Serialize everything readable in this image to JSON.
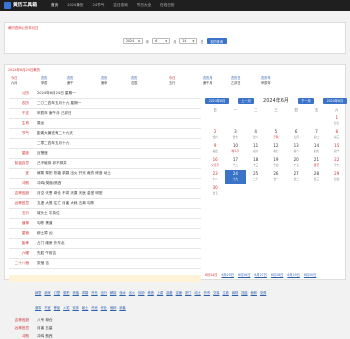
{
  "brand": {
    "name": "黄历工具箱",
    "sub": "www.xxx.com"
  },
  "nav": [
    "首页",
    "2024黄历",
    "24节气",
    "吉日查询",
    "节日大全",
    "在线日历"
  ],
  "query": {
    "title": "黄历查询公历年月日",
    "year": "2024",
    "year_unit": "年",
    "month": "6",
    "month_unit": "月",
    "day": "24",
    "day_unit": "日",
    "submit": "农历查询"
  },
  "main": {
    "title": "2024年6月24日黄历",
    "weekdays_row1": [
      "今日",
      "农历",
      "农历",
      "农历",
      "农历",
      "今日",
      "农历月",
      "农历日",
      "农历年"
    ],
    "weekdays_row2": [
      "六月",
      "甲辰",
      "庚午",
      "庚申",
      "戊辰",
      "五行",
      "庚午月",
      "乙卯日",
      "甲辰年"
    ],
    "info": [
      {
        "k": "公历",
        "v": "2024年6月24日 星期一"
      },
      {
        "k": "农历",
        "v": "二〇二四年五月十九 星期一"
      },
      {
        "k": "干支",
        "v": "甲辰年 庚午月 己卯日"
      },
      {
        "k": "生肖",
        "v": "属龙"
      },
      {
        "k": "节气",
        "v": "距离大暑还有二十九天"
      },
      {
        "k": "",
        "v": "二零二四年五月十九"
      },
      {
        "k": "星座",
        "v": "巨蟹座"
      },
      {
        "k": "彭祖百忌",
        "v": "己不破券 卯不穿井"
      },
      {
        "k": "宜",
        "v": "嫁娶 祭祀 祈福 求嗣 出火 开光 裁衣 修造 动土"
      },
      {
        "k": "冲煞",
        "v": "冲鸡(癸酉)煞西"
      },
      {
        "k": "吉神宜趋",
        "v": "月空 天恩 母仓 不将 天喜 天医 金堂 明堂"
      },
      {
        "k": "凶神宜忌",
        "v": "五虚 大煞 往亡 月害 大耗 五离 勾陈"
      },
      {
        "k": "五行",
        "v": "城头土 平执位"
      },
      {
        "k": "值神",
        "v": "勾陈 黑道"
      },
      {
        "k": "星宿",
        "v": "柳土獐 凶"
      },
      {
        "k": "胎神",
        "v": "占门 碓房 外东北"
      },
      {
        "k": "六曜",
        "v": "先胜 午前吉"
      },
      {
        "k": "二十八宿",
        "v": "张宿 吉"
      }
    ]
  },
  "calendar": {
    "today_btn": "2024年6月",
    "prev": "上一月",
    "title": "2024年6月",
    "next": "下一月",
    "back": "2024年6月",
    "week": [
      "日",
      "一",
      "二",
      "三",
      "四",
      "五",
      "六"
    ],
    "days": [
      {
        "n": "",
        "l": ""
      },
      {
        "n": "",
        "l": ""
      },
      {
        "n": "",
        "l": ""
      },
      {
        "n": "",
        "l": ""
      },
      {
        "n": "",
        "l": ""
      },
      {
        "n": "",
        "l": ""
      },
      {
        "n": "1",
        "l": "廿五"
      },
      {
        "n": "2",
        "l": "廿六"
      },
      {
        "n": "3",
        "l": "廿七"
      },
      {
        "n": "4",
        "l": "廿八"
      },
      {
        "n": "5",
        "l": "芒种"
      },
      {
        "n": "6",
        "l": "五月"
      },
      {
        "n": "7",
        "l": "初二"
      },
      {
        "n": "8",
        "l": "初三"
      },
      {
        "n": "9",
        "l": "初四"
      },
      {
        "n": "10",
        "l": "端午节"
      },
      {
        "n": "11",
        "l": "初六"
      },
      {
        "n": "12",
        "l": "初七"
      },
      {
        "n": "13",
        "l": "初八"
      },
      {
        "n": "14",
        "l": "初九"
      },
      {
        "n": "15",
        "l": "初十"
      },
      {
        "n": "16",
        "l": "父亲节"
      },
      {
        "n": "17",
        "l": "十二"
      },
      {
        "n": "18",
        "l": "十三"
      },
      {
        "n": "19",
        "l": "十四"
      },
      {
        "n": "20",
        "l": "十五"
      },
      {
        "n": "21",
        "l": "夏至"
      },
      {
        "n": "22",
        "l": "十七"
      },
      {
        "n": "23",
        "l": "十八"
      },
      {
        "n": "24",
        "l": "十九"
      },
      {
        "n": "25",
        "l": "二十"
      },
      {
        "n": "26",
        "l": "廿一"
      },
      {
        "n": "27",
        "l": "廿二"
      },
      {
        "n": "28",
        "l": "廿三"
      },
      {
        "n": "29",
        "l": "廿四"
      },
      {
        "n": "30",
        "l": "廿五"
      }
    ]
  },
  "tabs": [
    "6月24日",
    "6月25日",
    "6月26日",
    "6月27日",
    "6月28日",
    "6月29日",
    "6月30日"
  ],
  "links_row1": [
    "嫁娶",
    "纳采",
    "订盟",
    "祭祀",
    "祈福",
    "求嗣",
    "开光",
    "出行",
    "解除",
    "伐木",
    "出火",
    "拆卸",
    "修造",
    "上梁",
    "起基",
    "定磉",
    "安门",
    "动土",
    "开市",
    "交易",
    "立券",
    "纳财",
    "挂匾",
    "栽种",
    "安葬"
  ],
  "links_row2": [
    "诸事",
    "不宜",
    "移徙",
    "入宅",
    "安床",
    "破土",
    "开池",
    "作灶",
    "栽种",
    "纳畜"
  ],
  "footer_row": [
    {
      "k": "吉神宜趋",
      "v": "八专 母仓"
    },
    {
      "k": "凶神宜忌",
      "v": "月害 五墓"
    },
    {
      "k": "冲煞",
      "v": "冲鸡 煞西"
    }
  ]
}
